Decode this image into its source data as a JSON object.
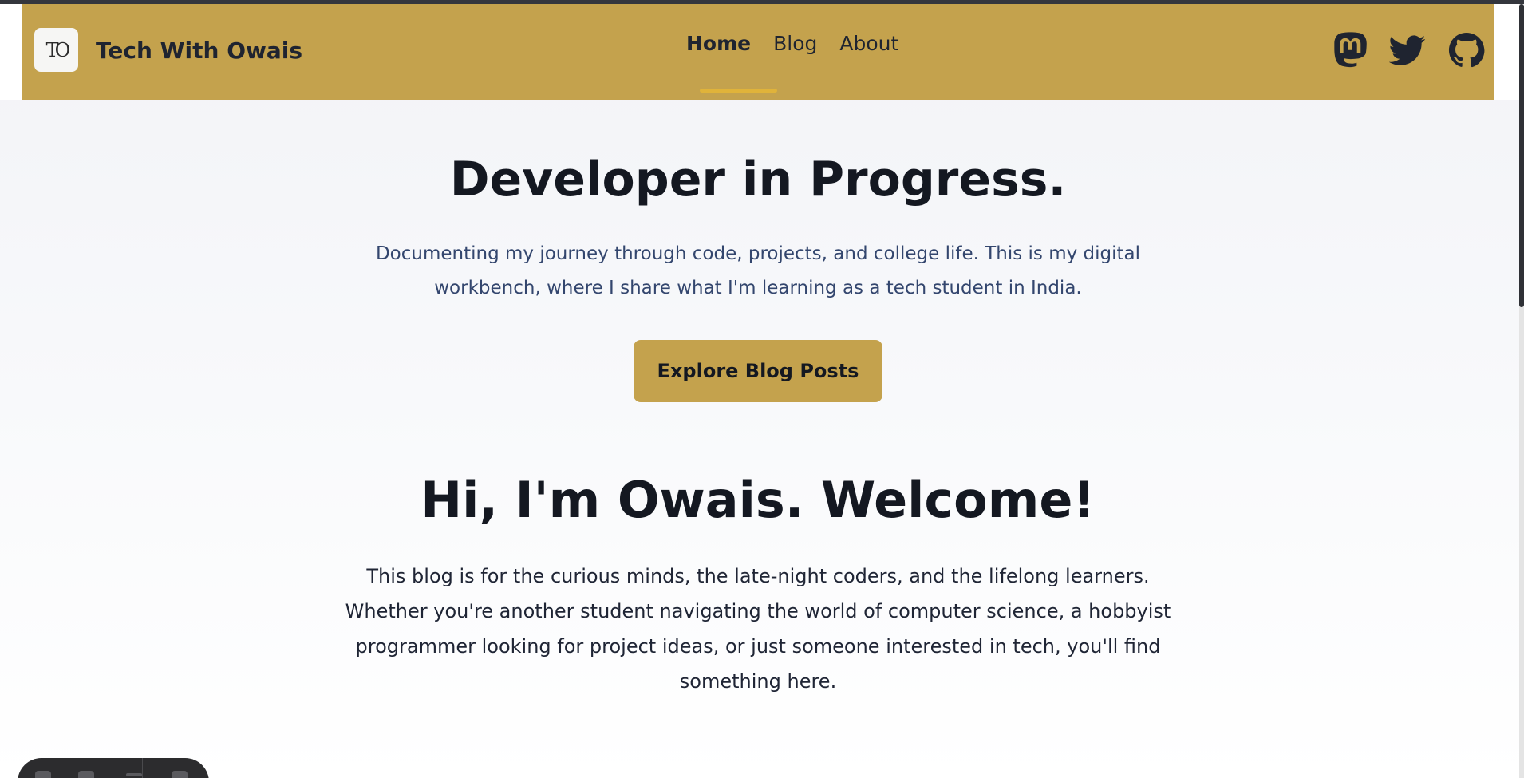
{
  "header": {
    "logo_text": "TO",
    "site_title": "Tech With Owais",
    "nav": [
      {
        "label": "Home",
        "active": true
      },
      {
        "label": "Blog",
        "active": false
      },
      {
        "label": "About",
        "active": false
      }
    ],
    "social_icons": [
      "mastodon-icon",
      "twitter-icon",
      "github-icon"
    ]
  },
  "hero": {
    "title": "Developer in Progress.",
    "subtitle": "Documenting my journey through code, projects, and college life. This is my digital workbench, where I share what I'm learning as a tech student in India.",
    "cta_label": "Explore Blog Posts"
  },
  "welcome": {
    "title": "Hi, I'm Owais. Welcome!",
    "body": "This blog is for the curious minds, the late-night coders, and the lifelong learners. Whether you're another student navigating the world of computer science, a hobbyist programmer looking for project ideas, or just someone interested in tech, you'll find something here."
  },
  "colors": {
    "brand_gold": "#c4a24d",
    "active_underline": "#e0b33a",
    "heading_text": "#141821",
    "subtitle_text": "#33466e"
  }
}
